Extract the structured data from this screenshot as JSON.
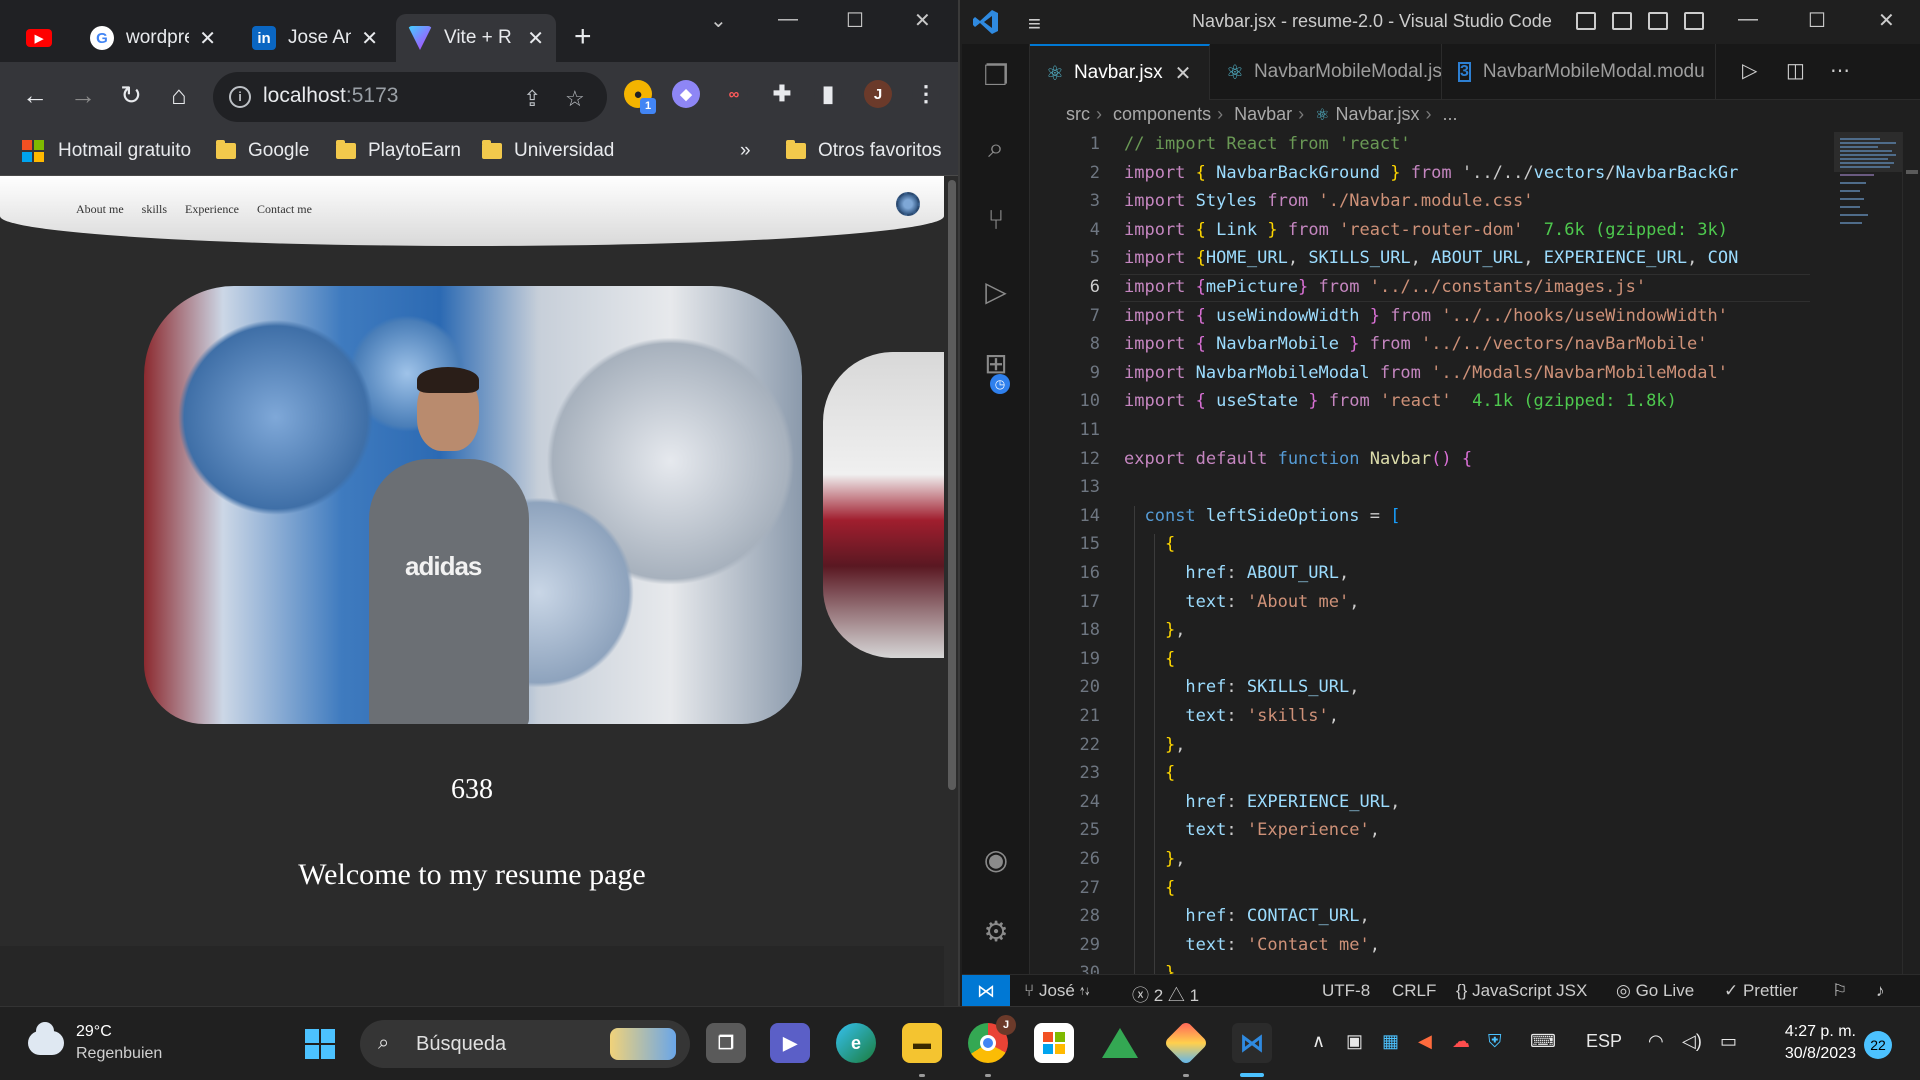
{
  "browser": {
    "tabs": [
      {
        "label": "",
        "icon": "youtube-icon"
      },
      {
        "label": "wordpre",
        "icon": "google-icon"
      },
      {
        "label": "Jose An",
        "icon": "linkedin-icon"
      },
      {
        "label": "Vite + R",
        "icon": "vite-icon"
      }
    ],
    "address": {
      "host": "localhost",
      "port": ":5173"
    },
    "profile_initial": "J",
    "extension_badge": "1",
    "bookmarks": [
      "Hotmail gratuito",
      "Google",
      "PlaytoEarn",
      "Universidad"
    ],
    "bookmarks_overflow": "»",
    "other_bookmarks": "Otros favoritos"
  },
  "page": {
    "nav_links": [
      "About me",
      "skills",
      "Experience",
      "Contact me"
    ],
    "counter": "638",
    "welcome": "Welcome to my resume page",
    "photo_shirt_text": "adidas"
  },
  "vscode": {
    "title": "Navbar.jsx - resume-2.0 - Visual Studio Code",
    "tabs": [
      "Navbar.jsx",
      "NavbarMobileModal.jsx",
      "NavbarMobileModal.modu"
    ],
    "breadcrumb": [
      "src",
      "components",
      "Navbar",
      "Navbar.jsx",
      "..."
    ],
    "current_line": 6,
    "code_lines": [
      "// import React from 'react'",
      "import { NavbarBackGround } from '../../vectors/NavbarBackGr",
      "import Styles from './Navbar.module.css'",
      "import { Link } from 'react-router-dom'  7.6k (gzipped: 3k)",
      "import {HOME_URL, SKILLS_URL, ABOUT_URL, EXPERIENCE_URL, CON",
      "import {mePicture} from '../../constants/images.js'",
      "import { useWindowWidth } from '../../hooks/useWindowWidth'",
      "import { NavbarMobile } from '../../vectors/navBarMobile'",
      "import NavbarMobileModal from '../Modals/NavbarMobileModal'",
      "import { useState } from 'react'  4.1k (gzipped: 1.8k)",
      "",
      "export default function Navbar() {",
      "",
      "  const leftSideOptions = [",
      "    {",
      "      href: ABOUT_URL,",
      "      text: 'About me',",
      "    },",
      "    {",
      "      href: SKILLS_URL,",
      "      text: 'skills',",
      "    },",
      "    {",
      "      href: EXPERIENCE_URL,",
      "      text: 'Experience',",
      "    },",
      "    {",
      "      href: CONTACT_URL,",
      "      text: 'Contact me',",
      "    },"
    ],
    "status": {
      "branch": "José",
      "errors": "2",
      "warnings": "1",
      "encoding": "UTF-8",
      "eol": "CRLF",
      "language": "JavaScript JSX",
      "golive": "Go Live",
      "prettier": "Prettier"
    }
  },
  "taskbar": {
    "temperature": "29°C",
    "weather": "Regenbuien",
    "search_placeholder": "Búsqueda",
    "language": "ESP",
    "time": "4:27 p. m.",
    "date": "30/8/2023",
    "notifications": "22",
    "chrome_badge": "J"
  },
  "colors": {
    "keyword": "#569cd6",
    "control": "#c586c0",
    "identifier": "#9cdcfe",
    "function": "#dcdcaa",
    "string": "#ce9178",
    "comment": "#6a9955",
    "size_hint": "#4ec94e",
    "brace_1": "#ffd700",
    "brace_2": "#da70d6",
    "brace_3": "#179fff",
    "accent": "#0078d4",
    "taskbar_accent": "#4cc2ff"
  }
}
